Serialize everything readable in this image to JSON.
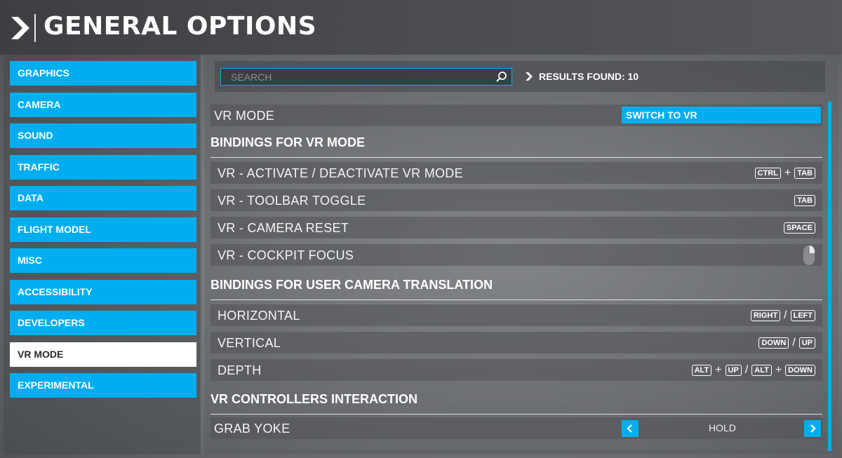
{
  "header": {
    "title": "GENERAL OPTIONS"
  },
  "sidebar": {
    "items": [
      {
        "label": "GRAPHICS"
      },
      {
        "label": "CAMERA"
      },
      {
        "label": "SOUND"
      },
      {
        "label": "TRAFFIC"
      },
      {
        "label": "DATA"
      },
      {
        "label": "FLIGHT MODEL"
      },
      {
        "label": "MISC"
      },
      {
        "label": "ACCESSIBILITY"
      },
      {
        "label": "DEVELOPERS"
      },
      {
        "label": "VR MODE"
      },
      {
        "label": "EXPERIMENTAL"
      }
    ],
    "active": "VR MODE"
  },
  "search": {
    "placeholder": "SEARCH",
    "results_label": "RESULTS FOUND: 10"
  },
  "vr_mode": {
    "label": "VR MODE",
    "button": "SWITCH TO VR"
  },
  "sections": {
    "vr_bindings": {
      "title": "BINDINGS FOR VR MODE",
      "rows": [
        {
          "label": "VR - ACTIVATE / DEACTIVATE VR MODE",
          "keys": [
            "CTRL",
            "+",
            "TAB"
          ]
        },
        {
          "label": "VR - TOOLBAR TOGGLE",
          "keys": [
            "TAB"
          ]
        },
        {
          "label": "VR - CAMERA RESET",
          "keys": [
            "SPACE"
          ]
        },
        {
          "label": "VR - COCKPIT FOCUS",
          "icon": "mouse-right-click-icon"
        }
      ]
    },
    "camera_translation": {
      "title": "BINDINGS FOR USER CAMERA TRANSLATION",
      "rows": [
        {
          "label": "HORIZONTAL",
          "keys": [
            "RIGHT",
            "/",
            "LEFT"
          ]
        },
        {
          "label": "VERTICAL",
          "keys": [
            "DOWN",
            "/",
            "UP"
          ]
        },
        {
          "label": "DEPTH",
          "keys": [
            "ALT",
            "+",
            "UP",
            "/",
            "ALT",
            "+",
            "DOWN"
          ]
        }
      ]
    },
    "controllers": {
      "title": "VR CONTROLLERS INTERACTION",
      "rows": [
        {
          "label": "GRAB YOKE",
          "value": "HOLD"
        }
      ]
    }
  },
  "colors": {
    "accent": "#00aeef",
    "active_nav": "#ffffff"
  }
}
